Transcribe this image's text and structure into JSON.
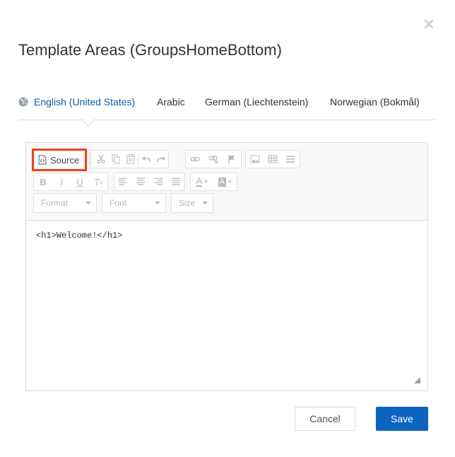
{
  "dialog": {
    "title": "Template Areas (GroupsHomeBottom)",
    "close_icon": "close-icon"
  },
  "tabs": [
    {
      "label": "English (United States)",
      "active": true,
      "icon": "globe-icon"
    },
    {
      "label": "Arabic",
      "active": false
    },
    {
      "label": "German (Liechtenstein)",
      "active": false
    },
    {
      "label": "Norwegian (Bokmål)",
      "active": false
    }
  ],
  "toolbar": {
    "source_label": "Source",
    "format_label": "Format",
    "font_label": "Font",
    "size_label": "Size"
  },
  "editor": {
    "content": "<h1>Welcome!</h1>"
  },
  "footer": {
    "cancel_label": "Cancel",
    "save_label": "Save"
  },
  "colors": {
    "accent": "#0b64c0",
    "active_tab": "#0b5fa5",
    "highlight": "#f2430e"
  }
}
